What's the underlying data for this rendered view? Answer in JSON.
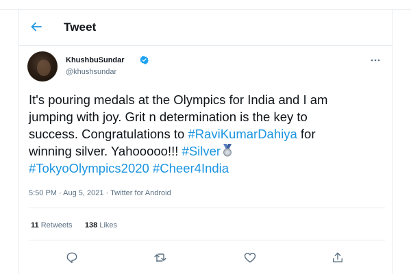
{
  "header": {
    "back_icon": "arrow-left-icon",
    "title": "Tweet"
  },
  "author": {
    "name": "KhushbuSundar",
    "handle": "@khushsundar",
    "verified_icon": "verified-badge-icon"
  },
  "tweet": {
    "line1": "It's pouring medals at the Olympics for India and I am",
    "line2": "jumping with joy. Grit n determination is the key to",
    "line3": "success. Congratulations to ",
    "line3_tag": "#RaviKumarDahiya",
    "line3_end": " for",
    "line4": "winning silver. Yahooooo!!! ",
    "line4_tag": "#Silver",
    "line4_emoji": "silver-medal-icon",
    "line5_tag1": "#TokyoOlympics2020",
    "line5_tag2": "#Cheer4India"
  },
  "meta": {
    "time": "5:50 PM",
    "sep": " · ",
    "date": "Aug 5, 2021",
    "source": "Twitter for Android"
  },
  "stats": {
    "retweets_count": "11",
    "retweets_label": "Retweets",
    "likes_count": "138",
    "likes_label": "Likes"
  },
  "actions": [
    "reply-icon",
    "retweet-icon",
    "like-icon",
    "share-icon"
  ],
  "colors": {
    "link": "#1b95e0",
    "muted": "#5b7083",
    "border": "#e6ecf0"
  }
}
